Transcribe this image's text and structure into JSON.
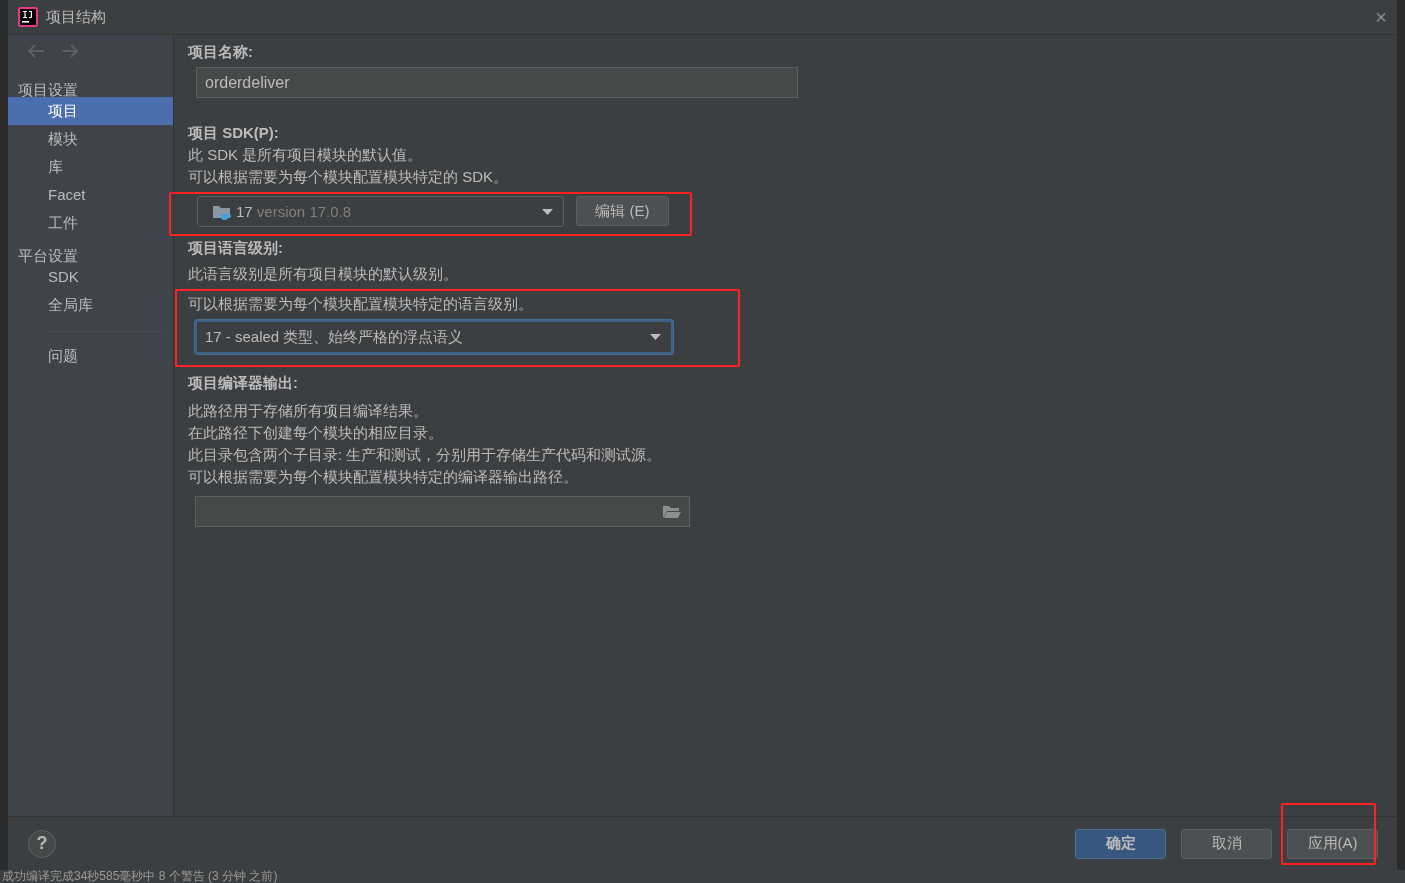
{
  "window": {
    "title": "项目结构",
    "close": "×"
  },
  "sidebar": {
    "sections": [
      {
        "heading": "项目设置",
        "items": [
          {
            "label": "项目",
            "selected": true
          },
          {
            "label": "模块",
            "selected": false
          },
          {
            "label": "库",
            "selected": false
          },
          {
            "label": "Facet",
            "selected": false
          },
          {
            "label": "工件",
            "selected": false
          }
        ]
      },
      {
        "heading": "平台设置",
        "items": [
          {
            "label": "SDK",
            "selected": false
          },
          {
            "label": "全局库",
            "selected": false
          }
        ]
      }
    ],
    "extra_items": [
      {
        "label": "问题",
        "selected": false
      }
    ]
  },
  "project_name": {
    "label": "项目名称:",
    "value": "orderdeliver"
  },
  "project_sdk": {
    "label": "项目 SDK(P):",
    "description": [
      "此 SDK 是所有项目模块的默认值。",
      "可以根据需要为每个模块配置模块特定的 SDK。"
    ],
    "selection": {
      "name": "17",
      "detail": "version 17.0.8"
    },
    "edit_button": "编辑 (E)",
    "highlighted": true
  },
  "language_level": {
    "label": "项目语言级别:",
    "description": [
      "此语言级别是所有项目模块的默认级别。",
      "可以根据需要为每个模块配置模块特定的语言级别。"
    ],
    "value": "17 - sealed 类型、始终严格的浮点语义",
    "focused": true,
    "highlighted": true
  },
  "compiler_output": {
    "label": "项目编译器输出:",
    "description": [
      "此路径用于存储所有项目编译结果。",
      "在此路径下创建每个模块的相应目录。",
      "此目录包含两个子目录: 生产和测试，分别用于存储生产代码和测试源。",
      "可以根据需要为每个模块配置模块特定的编译器输出路径。"
    ]
  },
  "footer": {
    "help": "?",
    "buttons": [
      {
        "label": "确定",
        "kind": "primary",
        "highlighted": false
      },
      {
        "label": "取消",
        "kind": "normal",
        "highlighted": false
      },
      {
        "label": "应用(A)",
        "kind": "normal",
        "highlighted": true
      }
    ]
  },
  "status_bar": {
    "text": "成功编译完成34秒585毫秒中 8 个警告 (3 分钟 之前)"
  }
}
